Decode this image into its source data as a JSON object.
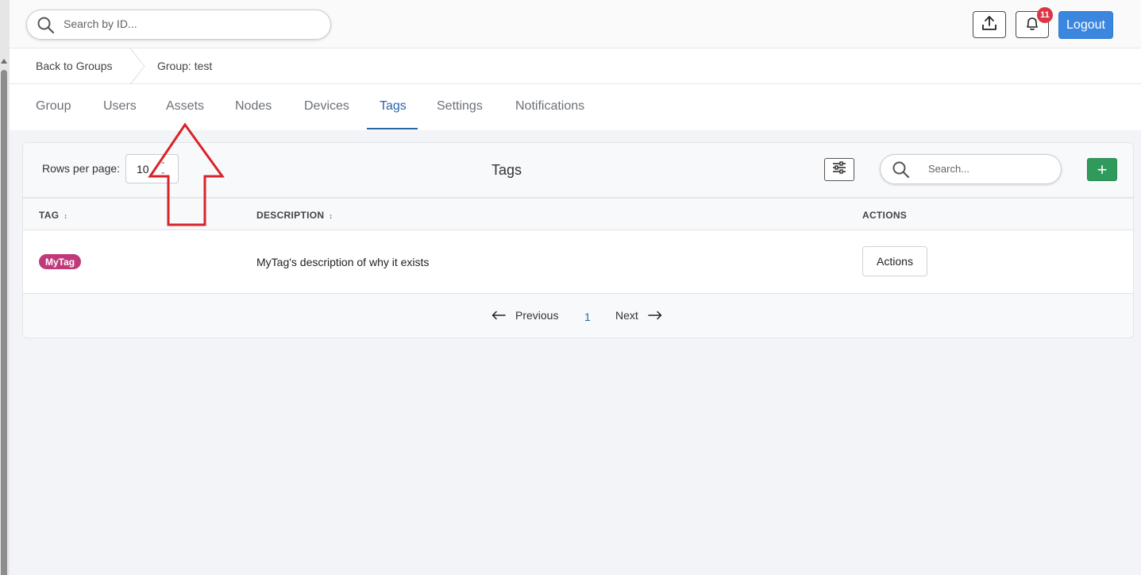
{
  "topbar": {
    "search_placeholder": "Search by ID...",
    "notifications_count": "11",
    "logout_label": "Logout"
  },
  "breadcrumb": {
    "back_label": "Back to Groups",
    "current_label": "Group: test"
  },
  "tabs": [
    {
      "label": "Group"
    },
    {
      "label": "Users"
    },
    {
      "label": "Assets"
    },
    {
      "label": "Nodes"
    },
    {
      "label": "Devices"
    },
    {
      "label": "Tags",
      "active": true
    },
    {
      "label": "Settings"
    },
    {
      "label": "Notifications"
    }
  ],
  "tags_card": {
    "rows_per_page_label": "Rows per page:",
    "rows_per_page_value": "10",
    "title": "Tags",
    "search_placeholder": "Search...",
    "add_label": "+",
    "columns": [
      "TAG",
      "DESCRIPTION",
      "ACTIONS"
    ],
    "rows": [
      {
        "tag": "MyTag",
        "description": "MyTag's description of why it exists",
        "action_label": "Actions"
      }
    ],
    "pagination": {
      "previous_label": "Previous",
      "current_page": "1",
      "next_label": "Next"
    }
  },
  "colors": {
    "accent": "#2c64a8",
    "logout": "#3b87e0",
    "add": "#2f9a5b",
    "tag_pill": "#c0397b",
    "badge": "#dc3545",
    "annotation_arrow": "#d9232a"
  }
}
